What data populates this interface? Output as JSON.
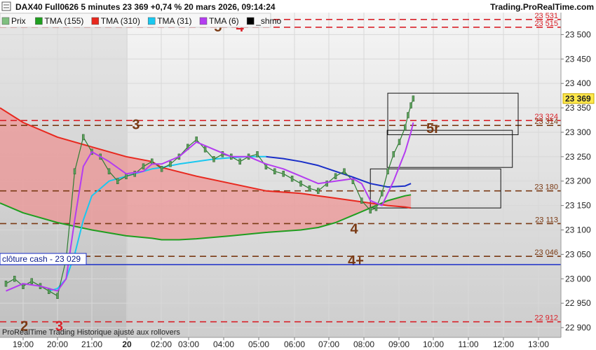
{
  "header": {
    "title": "DAX40 Full0626 5 minutes 23 369 +0,74 % 20 mars 2026, 09:14:24",
    "site": "Trading.ProRealTime.com"
  },
  "legend": [
    {
      "label": "Prix",
      "color": "#7fbf7f"
    },
    {
      "label": "TMA (155)",
      "color": "#1f9e1f"
    },
    {
      "label": "TMA (310)",
      "color": "#e8281e"
    },
    {
      "label": "TMA (31)",
      "color": "#19c8f0"
    },
    {
      "label": "TMA (6)",
      "color": "#b43cf0"
    },
    {
      "label": "_shmo",
      "color": "#000000"
    }
  ],
  "footer": "ProRealTime Trading  Historique ajusté aux rollovers",
  "cash_close": {
    "label": "clôture cash - 23 029",
    "value": 23029
  },
  "last_price": {
    "label": "23 369",
    "value": 23369
  },
  "colors": {
    "red_levels": "#d9222a",
    "brown_levels": "#7a3a14",
    "grid": "#dcdcdc",
    "weekend_shade": "#e6e6e6",
    "bg_gradient_top": "#f4f4f4",
    "bg_gradient_bottom": "#cfcfcf"
  },
  "chart_data": {
    "type": "line",
    "x_ticks": [
      "19:00",
      "20:00",
      "21:00",
      "20",
      "02:00",
      "03:00",
      "04:00",
      "05:00",
      "06:00",
      "07:00",
      "08:00",
      "09:00",
      "10:00",
      "11:00",
      "12:00",
      "13:00"
    ],
    "y_ticks": [
      "22 900",
      "22 950",
      "23 000",
      "23 050",
      "23 100",
      "23 150",
      "23 200",
      "23 250",
      "23 300",
      "23 350",
      "23 400",
      "23 450",
      "23 500"
    ],
    "ylim": [
      22880,
      23545
    ],
    "grid": true,
    "levels": [
      {
        "value": 23531,
        "label": "23 531",
        "color": "#d9222a"
      },
      {
        "value": 23515,
        "label": "23 515",
        "color": "#d9222a"
      },
      {
        "value": 23324,
        "label": "23 324",
        "color": "#d9222a"
      },
      {
        "value": 23314,
        "label": "23 314",
        "color": "#7a3a14"
      },
      {
        "value": 23180,
        "label": "23 180",
        "color": "#7a3a14"
      },
      {
        "value": 23113,
        "label": "23 113",
        "color": "#7a3a14"
      },
      {
        "value": 23046,
        "label": "23 046",
        "color": "#7a3a14"
      },
      {
        "value": 22912,
        "label": "22 912",
        "color": "#d9222a"
      }
    ],
    "wave_labels": [
      {
        "text": "5",
        "x": "03:37",
        "y": 23518,
        "color": "#7a3a14"
      },
      {
        "text": "4",
        "x": "04:15",
        "y": 23518,
        "color": "#d9222a"
      },
      {
        "text": "3",
        "x": "22:17",
        "y": 23318,
        "color": "#7a3a14"
      },
      {
        "text": "5r",
        "x": "09:48",
        "y": 23310,
        "color": "#7a3a14"
      },
      {
        "text": "4",
        "x": "07:32",
        "y": 23104,
        "color": "#7a3a14"
      },
      {
        "text": "4+",
        "x": "07:35",
        "y": 23039,
        "color": "#7a3a14"
      },
      {
        "text": "2",
        "x": "19:02",
        "y": 22905,
        "color": "#7a3a14"
      },
      {
        "text": "3",
        "x": "20:03",
        "y": 22905,
        "color": "#d9222a"
      }
    ],
    "boxes": [
      {
        "x0": "08:30",
        "x1": "12:15",
        "y0": 23295,
        "y1": 23380
      },
      {
        "x0": "08:29",
        "x1": "12:05",
        "y0": 23228,
        "y1": 23304
      },
      {
        "x0": "08:00",
        "x1": "11:45",
        "y0": 23145,
        "y1": 23225
      }
    ],
    "series": [
      {
        "name": "Prix",
        "color": "#2e7d32",
        "x": [
          "18:30",
          "18:45",
          "19:00",
          "19:15",
          "19:30",
          "19:45",
          "20:00",
          "20:15",
          "20:30",
          "20:45",
          "21:00",
          "21:15",
          "21:30",
          "21:45",
          "22:00",
          "22:15",
          "22:30",
          "22:45",
          "02:00",
          "02:15",
          "02:30",
          "02:45",
          "03:00",
          "03:15",
          "03:30",
          "03:45",
          "04:00",
          "04:15",
          "04:30",
          "04:45",
          "05:00",
          "05:15",
          "05:30",
          "05:45",
          "06:00",
          "06:15",
          "06:30",
          "06:45",
          "07:00",
          "07:15",
          "07:30",
          "07:45",
          "08:00",
          "08:10",
          "08:20",
          "08:30",
          "08:40",
          "08:50",
          "09:00",
          "09:05",
          "09:10",
          "09:14"
        ],
        "y": [
          22990,
          23000,
          22985,
          22995,
          22985,
          22975,
          22965,
          23040,
          23220,
          23290,
          23260,
          23250,
          23220,
          23200,
          23210,
          23215,
          23230,
          23240,
          23225,
          23235,
          23250,
          23270,
          23285,
          23265,
          23245,
          23255,
          23250,
          23240,
          23250,
          23255,
          23230,
          23220,
          23215,
          23205,
          23195,
          23185,
          23180,
          23195,
          23210,
          23220,
          23200,
          23160,
          23140,
          23145,
          23175,
          23220,
          23255,
          23280,
          23310,
          23335,
          23355,
          23369
        ]
      },
      {
        "name": "TMA (6)",
        "color": "#b43cf0",
        "x": [
          "18:30",
          "19:00",
          "19:30",
          "20:00",
          "20:15",
          "20:30",
          "20:45",
          "21:00",
          "21:30",
          "22:00",
          "22:30",
          "22:45",
          "02:00",
          "02:30",
          "03:00",
          "03:30",
          "04:00",
          "04:30",
          "05:00",
          "05:30",
          "06:00",
          "06:30",
          "07:00",
          "07:30",
          "07:45",
          "08:00",
          "08:20",
          "08:40",
          "09:00",
          "09:10",
          "09:14"
        ],
        "y": [
          22975,
          22990,
          22985,
          22975,
          23000,
          23120,
          23230,
          23260,
          23240,
          23215,
          23220,
          23235,
          23235,
          23250,
          23280,
          23265,
          23250,
          23250,
          23235,
          23225,
          23210,
          23195,
          23200,
          23205,
          23195,
          23160,
          23150,
          23200,
          23260,
          23300,
          23320
        ]
      },
      {
        "name": "TMA (31)",
        "color": "#19c8f0",
        "x": [
          "19:45",
          "20:00",
          "20:15",
          "20:30",
          "20:45",
          "21:00",
          "21:30",
          "22:00",
          "22:30",
          "22:45",
          "02:00",
          "02:30",
          "03:00",
          "03:30",
          "04:00",
          "04:30",
          "05:00"
        ],
        "y": [
          22975,
          22980,
          23000,
          23050,
          23120,
          23170,
          23200,
          23210,
          23220,
          23225,
          23228,
          23235,
          23240,
          23245,
          23248,
          23250,
          23250
        ]
      },
      {
        "name": "_shmo",
        "color": "#1a2fc8",
        "x": [
          "05:00",
          "05:30",
          "06:00",
          "06:30",
          "07:00",
          "07:30",
          "08:00",
          "08:30",
          "09:00",
          "09:10"
        ],
        "y": [
          23250,
          23246,
          23240,
          23232,
          23220,
          23208,
          23195,
          23188,
          23190,
          23195
        ]
      },
      {
        "name": "TMA (155)",
        "color": "#1f9e1f",
        "x": [
          "18:00",
          "19:00",
          "20:00",
          "21:00",
          "22:00",
          "22:45",
          "02:00",
          "02:30",
          "03:00",
          "04:00",
          "05:00",
          "06:00",
          "06:30",
          "07:00",
          "07:30",
          "08:00",
          "08:30",
          "09:00",
          "09:10"
        ],
        "y": [
          23155,
          23135,
          23115,
          23100,
          23088,
          23083,
          23080,
          23080,
          23082,
          23088,
          23095,
          23100,
          23105,
          23115,
          23130,
          23145,
          23160,
          23170,
          23172
        ]
      },
      {
        "name": "TMA (310)",
        "color": "#e8281e",
        "x": [
          "18:00",
          "19:00",
          "20:00",
          "21:00",
          "22:00",
          "22:45",
          "02:00",
          "03:00",
          "04:00",
          "05:00",
          "06:00",
          "06:30",
          "07:00",
          "07:30",
          "08:00",
          "08:30",
          "09:00",
          "09:10"
        ],
        "y": [
          23350,
          23320,
          23290,
          23270,
          23250,
          23240,
          23228,
          23210,
          23195,
          23180,
          23175,
          23170,
          23165,
          23160,
          23155,
          23150,
          23147,
          23145
        ]
      }
    ]
  }
}
